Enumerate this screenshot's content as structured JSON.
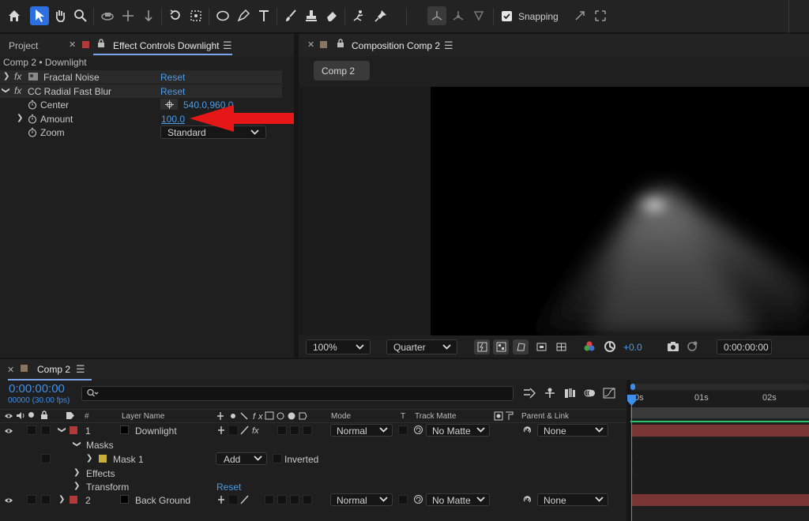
{
  "toolbar": {
    "tools": [
      "home-icon",
      "selection-tool-icon",
      "hand-tool-icon",
      "zoom-tool-icon",
      "orbit-camera-icon",
      "pan-camera-icon",
      "dolly-camera-icon",
      "rotation-tool-icon",
      "pan-behind-icon",
      "shape-tool-icon",
      "pen-tool-icon",
      "type-tool-icon",
      "brush-tool-icon",
      "clone-stamp-icon",
      "eraser-tool-icon",
      "roto-brush-icon",
      "puppet-pin-icon"
    ],
    "snapping_label": "Snapping",
    "snapping_checked": true
  },
  "left_panel": {
    "tab_project": "Project",
    "tab_effect_controls": "Effect Controls Downlight",
    "subtitle": "Comp 2 • Downlight",
    "effects": [
      {
        "name": "Fractal Noise",
        "reset": "Reset"
      },
      {
        "name": "CC Radial Fast Blur",
        "reset": "Reset"
      }
    ],
    "properties": [
      {
        "name": "Center",
        "value": "540.0,960.0"
      },
      {
        "name": "Amount",
        "value": "100.0"
      },
      {
        "name": "Zoom",
        "value": "Standard"
      }
    ],
    "accent_color": "#4a9ce8",
    "arrow_color": "#e61717"
  },
  "comp_panel": {
    "tab": "Composition Comp 2",
    "comp_button": "Comp 2",
    "footer": {
      "zoom": "100%",
      "resolution": "Quarter",
      "exposure": "+0.0",
      "timecode": "0:00:00:00"
    }
  },
  "timeline": {
    "tab": "Comp 2",
    "timecode": "0:00:00:00",
    "frames": "00000 (30.00 fps)",
    "search_placeholder": "",
    "columns": {
      "num": "#",
      "layer_name": "Layer Name",
      "mode": "Mode",
      "t": "T",
      "track_matte": "Track Matte",
      "parent": "Parent & Link"
    },
    "layers": [
      {
        "num": "1",
        "name": "Downlight",
        "mode": "Normal",
        "matte": "No Matte",
        "parent": "None",
        "label_color": "#b33a3a"
      },
      {
        "num": "2",
        "name": "Back Ground",
        "mode": "Normal",
        "matte": "No Matte",
        "parent": "None",
        "label_color": "#b33a3a"
      }
    ],
    "masks_label": "Masks",
    "mask_name": "Mask 1",
    "mask_mode": "Add",
    "mask_inverted": "Inverted",
    "effects_label": "Effects",
    "transform_label": "Transform",
    "transform_reset": "Reset",
    "ruler": [
      "0s",
      "01s",
      "02s"
    ],
    "bar_color": "#7a3535",
    "work_area_color": "#2bc46a"
  }
}
